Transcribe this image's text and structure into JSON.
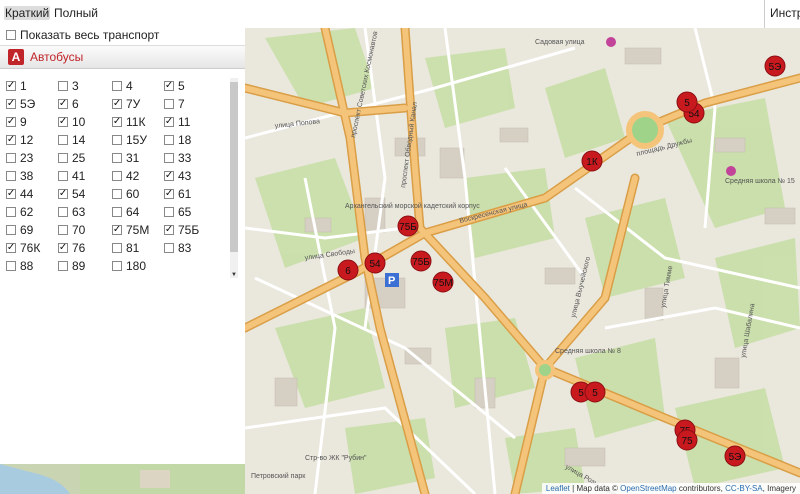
{
  "tabs": [
    {
      "label": "Краткий",
      "active": true
    },
    {
      "label": "Полный",
      "active": false
    }
  ],
  "topright": "Инстр",
  "show_all": {
    "label": "Показать весь транспорт",
    "checked": false
  },
  "section": {
    "icon": "А",
    "title": "Автобусы"
  },
  "routes": [
    {
      "label": "1",
      "checked": true
    },
    {
      "label": "3",
      "checked": false
    },
    {
      "label": "4",
      "checked": false
    },
    {
      "label": "5",
      "checked": true
    },
    {
      "label": "5Э",
      "checked": true
    },
    {
      "label": "6",
      "checked": true
    },
    {
      "label": "7У",
      "checked": true
    },
    {
      "label": "7",
      "checked": false
    },
    {
      "label": "9",
      "checked": true
    },
    {
      "label": "10",
      "checked": true
    },
    {
      "label": "11К",
      "checked": true
    },
    {
      "label": "11",
      "checked": true
    },
    {
      "label": "12",
      "checked": true
    },
    {
      "label": "14",
      "checked": false
    },
    {
      "label": "15У",
      "checked": false
    },
    {
      "label": "18",
      "checked": false
    },
    {
      "label": "23",
      "checked": false
    },
    {
      "label": "25",
      "checked": false
    },
    {
      "label": "31",
      "checked": false
    },
    {
      "label": "33",
      "checked": false
    },
    {
      "label": "38",
      "checked": false
    },
    {
      "label": "41",
      "checked": false
    },
    {
      "label": "42",
      "checked": false
    },
    {
      "label": "43",
      "checked": true
    },
    {
      "label": "44",
      "checked": true
    },
    {
      "label": "54",
      "checked": true
    },
    {
      "label": "60",
      "checked": false
    },
    {
      "label": "61",
      "checked": true
    },
    {
      "label": "62",
      "checked": false
    },
    {
      "label": "63",
      "checked": false
    },
    {
      "label": "64",
      "checked": false
    },
    {
      "label": "65",
      "checked": false
    },
    {
      "label": "69",
      "checked": false
    },
    {
      "label": "70",
      "checked": false
    },
    {
      "label": "75М",
      "checked": true
    },
    {
      "label": "75Б",
      "checked": true
    },
    {
      "label": "76К",
      "checked": true
    },
    {
      "label": "76",
      "checked": true
    },
    {
      "label": "81",
      "checked": false
    },
    {
      "label": "83",
      "checked": false
    },
    {
      "label": "88",
      "checked": false
    },
    {
      "label": "89",
      "checked": false
    },
    {
      "label": "180",
      "checked": false
    }
  ],
  "map": {
    "streets": [
      {
        "label": "Воскресенская улица"
      },
      {
        "label": "проспект Советских Космонавтов"
      },
      {
        "label": "улица Выучейского"
      },
      {
        "label": "проспект Обводный Канал"
      },
      {
        "label": "улица Попова"
      },
      {
        "label": "улица Тимме"
      },
      {
        "label": "улица Розы Шаниной"
      },
      {
        "label": "улица Свободы"
      },
      {
        "label": "улица Шабалина"
      },
      {
        "label": "Садовая улица"
      },
      {
        "label": "площадь Дружбы"
      }
    ],
    "labels": [
      {
        "label": "Средняя школа № 15"
      },
      {
        "label": "Средняя школа № 8"
      },
      {
        "label": "Архангельский морской кадетский корпус"
      },
      {
        "label": "Петровский парк"
      },
      {
        "label": "Стр-во ЖК \"Рубин\""
      }
    ],
    "bus_markers": [
      {
        "label": "5Э"
      },
      {
        "label": "54"
      },
      {
        "label": "5"
      },
      {
        "label": "1К"
      },
      {
        "label": "75Б"
      },
      {
        "label": "54"
      },
      {
        "label": "6"
      },
      {
        "label": "75Б"
      },
      {
        "label": "75М"
      },
      {
        "label": "5"
      },
      {
        "label": "5"
      },
      {
        "label": "75"
      },
      {
        "label": "75"
      },
      {
        "label": "5Э"
      }
    ],
    "attribution": {
      "leaflet": "Leaflet",
      "map_data": "Map data ©",
      "osm": "OpenStreetMap",
      "contrib": "contributors,",
      "license": "CC-BY-SA",
      "imagery": "Imagery"
    }
  }
}
